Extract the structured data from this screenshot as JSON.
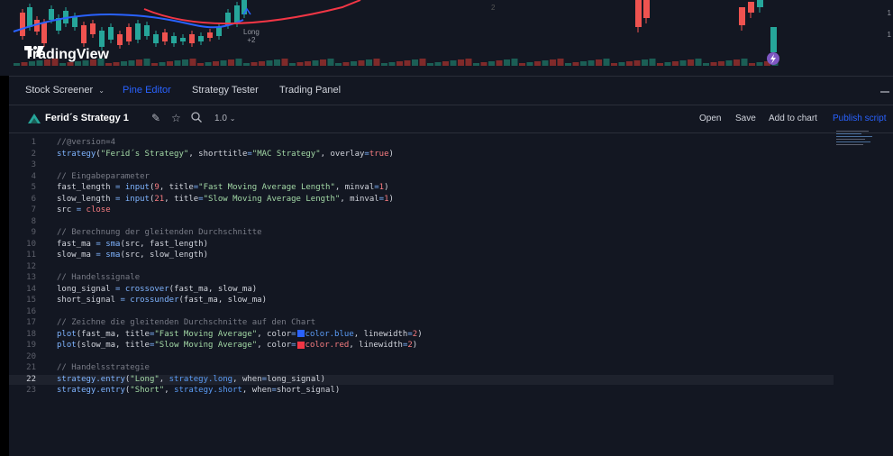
{
  "chart": {
    "brand": "TradingView",
    "signal_label": "Long",
    "signal_value": "+2",
    "top_tick": "2",
    "right_ticks": [
      "1",
      "1"
    ],
    "colors": {
      "up": "#26a69a",
      "down": "#ef5350",
      "bg": "#131722",
      "ma_fast": "#2962ff",
      "ma_slow": "#f23645"
    }
  },
  "tabs": [
    {
      "label": "Stock Screener",
      "has_chevron": true,
      "active": false
    },
    {
      "label": "Pine Editor",
      "active": true
    },
    {
      "label": "Strategy Tester",
      "active": false
    },
    {
      "label": "Trading Panel",
      "active": false
    }
  ],
  "toolbar": {
    "strategy_name": "Ferid´s Strategy 1",
    "version": "1.0",
    "icons": [
      "pencil-icon",
      "star-icon",
      "search-icon",
      "chevron-down-icon"
    ],
    "open_label": "Open",
    "save_label": "Save",
    "add_label": "Add to chart",
    "publish_label": "Publish script"
  },
  "editor": {
    "active_line": 22,
    "lines": [
      "//@version=4",
      "strategy(\"Ferid´s Strategy\", shorttitle=\"MAC Strategy\", overlay=true)",
      "",
      "// Eingabeparameter",
      "fast_length = input(9, title=\"Fast Moving Average Length\", minval=1)",
      "slow_length = input(21, title=\"Slow Moving Average Length\", minval=1)",
      "src = close",
      "",
      "// Berechnung der gleitenden Durchschnitte",
      "fast_ma = sma(src, fast_length)",
      "slow_ma = sma(src, slow_length)",
      "",
      "// Handelssignale",
      "long_signal = crossover(fast_ma, slow_ma)",
      "short_signal = crossunder(fast_ma, slow_ma)",
      "",
      "// Zeichne die gleitenden Durchschnitte auf den Chart",
      "plot(fast_ma, title=\"Fast Moving Average\", color=color.blue, linewidth=2)",
      "plot(slow_ma, title=\"Slow Moving Average\", color=color.red, linewidth=2)",
      "",
      "// Handelsstrategie",
      "strategy.entry(\"Long\", strategy.long, when=long_signal)",
      "strategy.entry(\"Short\", strategy.short, when=short_signal)"
    ]
  }
}
